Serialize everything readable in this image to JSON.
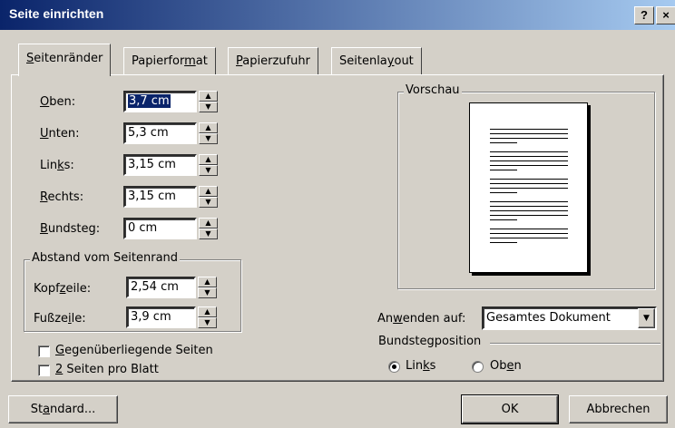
{
  "window": {
    "title": "Seite einrichten",
    "help_button": "?",
    "close_button": "×"
  },
  "tabs": [
    {
      "pre": "",
      "key": "S",
      "post": "eitenränder"
    },
    {
      "pre": "Papierfor",
      "key": "m",
      "post": "at"
    },
    {
      "pre": "",
      "key": "P",
      "post": "apierzufuhr"
    },
    {
      "pre": "Seitenla",
      "key": "y",
      "post": "out"
    }
  ],
  "margins": {
    "top": {
      "pre": "",
      "key": "O",
      "post": "ben:",
      "value": "3,7 cm"
    },
    "bottom": {
      "pre": "",
      "key": "U",
      "post": "nten:",
      "value": "5,3 cm"
    },
    "left": {
      "pre": "Lin",
      "key": "k",
      "post": "s:",
      "value": "3,15 cm"
    },
    "right": {
      "pre": "",
      "key": "R",
      "post": "echts:",
      "value": "3,15 cm"
    },
    "gutter": {
      "pre": "",
      "key": "B",
      "post": "undsteg:",
      "value": "0 cm"
    }
  },
  "distance_group": {
    "legend": "Abstand vom Seitenrand",
    "header": {
      "pre": "Kopf",
      "key": "z",
      "post": "eile:",
      "value": "2,54 cm"
    },
    "footer": {
      "pre": "Fußze",
      "key": "i",
      "post": "le:",
      "value": "3,9 cm"
    }
  },
  "preview": {
    "legend": "Vorschau"
  },
  "apply": {
    "pre": "An",
    "key": "w",
    "post": "enden auf:",
    "value": "Gesamtes Dokument"
  },
  "gutter_position": {
    "legend": "Bundstegposition",
    "left": {
      "pre": "Lin",
      "key": "k",
      "post": "s",
      "selected": true
    },
    "top": {
      "pre": "Ob",
      "key": "e",
      "post": "n",
      "selected": false
    }
  },
  "checkboxes": {
    "mirror": {
      "pre": "",
      "key": "G",
      "post": "egenüberliegende Seiten",
      "checked": false
    },
    "two_pages": {
      "pre": "",
      "key": "2",
      "post": " Seiten pro Blatt",
      "checked": false
    }
  },
  "buttons": {
    "standard": {
      "pre": "St",
      "key": "a",
      "post": "ndard..."
    },
    "ok": "OK",
    "cancel": "Abbrechen"
  }
}
